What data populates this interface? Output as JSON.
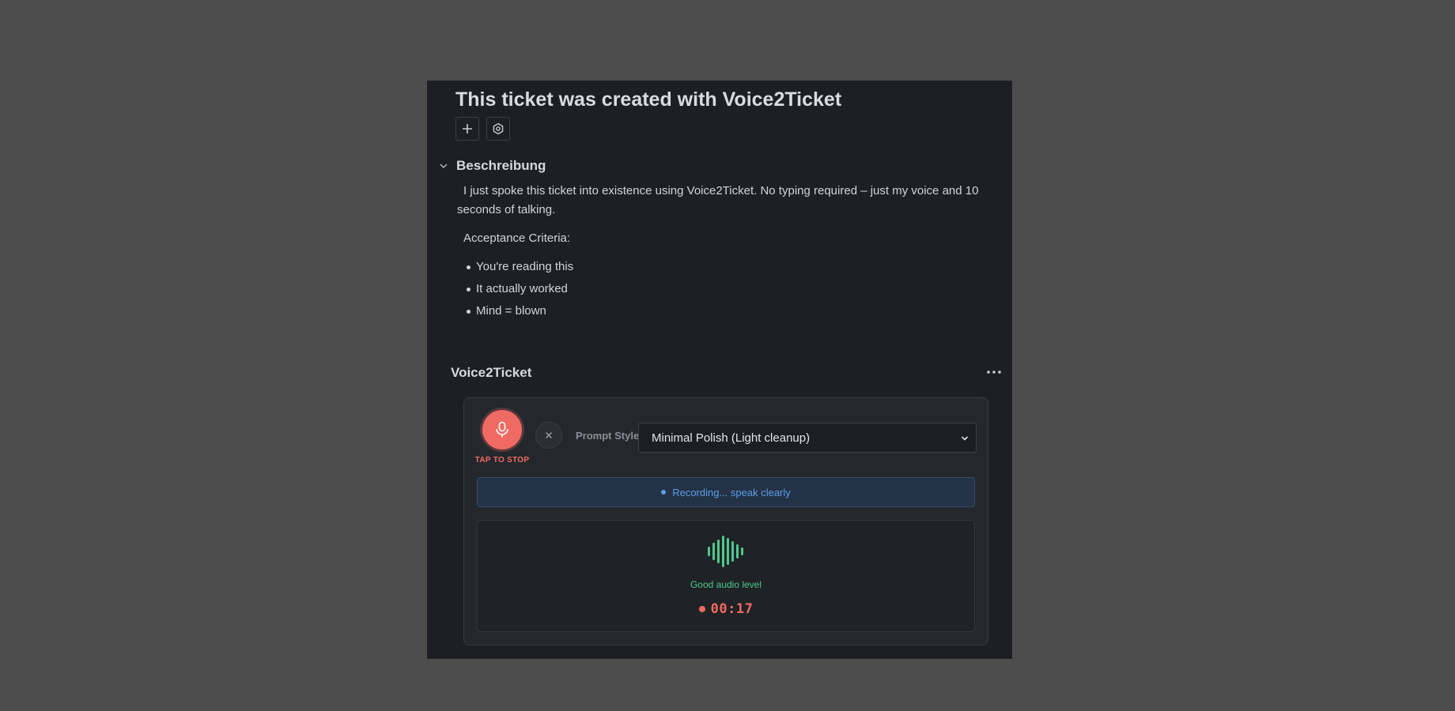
{
  "ticket": {
    "title": "This ticket was created with Voice2Ticket"
  },
  "toolbar": {
    "add_icon": "plus-icon",
    "settings_icon": "hexagon-settings-icon"
  },
  "description": {
    "section_title": "Beschreibung",
    "paragraph": "I just spoke this ticket into existence using Voice2Ticket. No typing required – just my voice and 10 seconds of talking.",
    "criteria_heading": "Acceptance Criteria:",
    "criteria": [
      "You're reading this",
      "It actually worked",
      "Mind = blown"
    ]
  },
  "widget": {
    "title": "Voice2Ticket",
    "more_icon": "ellipsis-icon",
    "recorder": {
      "mic_icon": "microphone-icon",
      "tap_label": "TAP TO STOP",
      "cancel_icon": "close-icon",
      "prompt_label": "Prompt Style",
      "prompt_selected": "Minimal Polish (Light cleanup)",
      "status_text": "Recording... speak clearly",
      "audio_level_text": "Good audio level",
      "timer": "00:17"
    },
    "colors": {
      "record": "#f06a64",
      "status": "#5d9de8",
      "audio_good": "#4fc88d"
    }
  }
}
